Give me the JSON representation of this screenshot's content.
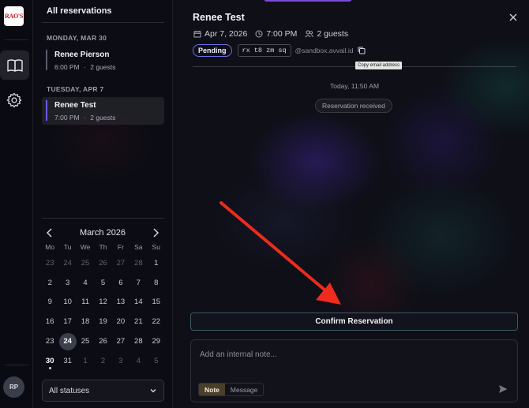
{
  "rail": {
    "logo_text": "RAO'S",
    "avatar_initials": "RP"
  },
  "list": {
    "title": "All reservations",
    "groups": [
      {
        "day": "MONDAY, MAR 30",
        "items": [
          {
            "name": "Renee Pierson",
            "time": "6:00 PM",
            "separator": "·",
            "guests": "2 guests"
          }
        ]
      },
      {
        "day": "TUESDAY, APR 7",
        "items": [
          {
            "name": "Renee Test",
            "time": "7:00 PM",
            "separator": "·",
            "guests": "2 guests"
          }
        ]
      }
    ]
  },
  "calendar": {
    "month_label": "March 2026",
    "weekdays": [
      "Mo",
      "Tu",
      "We",
      "Th",
      "Fr",
      "Sa",
      "Su"
    ],
    "weeks": [
      [
        "23",
        "24",
        "25",
        "26",
        "27",
        "28",
        "1"
      ],
      [
        "2",
        "3",
        "4",
        "5",
        "6",
        "7",
        "8"
      ],
      [
        "9",
        "10",
        "11",
        "12",
        "13",
        "14",
        "15"
      ],
      [
        "16",
        "17",
        "18",
        "19",
        "20",
        "21",
        "22"
      ],
      [
        "23",
        "24",
        "25",
        "26",
        "27",
        "28",
        "29"
      ],
      [
        "30",
        "31",
        "1",
        "2",
        "3",
        "4",
        "5"
      ]
    ],
    "selected_day": "24",
    "today_day": "30"
  },
  "status_filter": {
    "value": "All statuses"
  },
  "detail": {
    "title": "Renee Test",
    "date": "Apr 7, 2026",
    "time": "7:00 PM",
    "guests": "2 guests",
    "status_badge": "Pending",
    "code": "rx t8 zm sq",
    "email_domain": "@sandbox.avvail.id",
    "copy_tooltip": "Copy email address",
    "timestamp": "Today, 11:50 AM",
    "event": "Reservation received",
    "confirm_label": "Confirm Reservation",
    "note_placeholder": "Add an internal note...",
    "mode_note": "Note",
    "mode_message": "Message"
  },
  "colors": {
    "accent": "#6a5cff",
    "arrow": "#ee2b1c",
    "logo_red": "#c0151b"
  }
}
